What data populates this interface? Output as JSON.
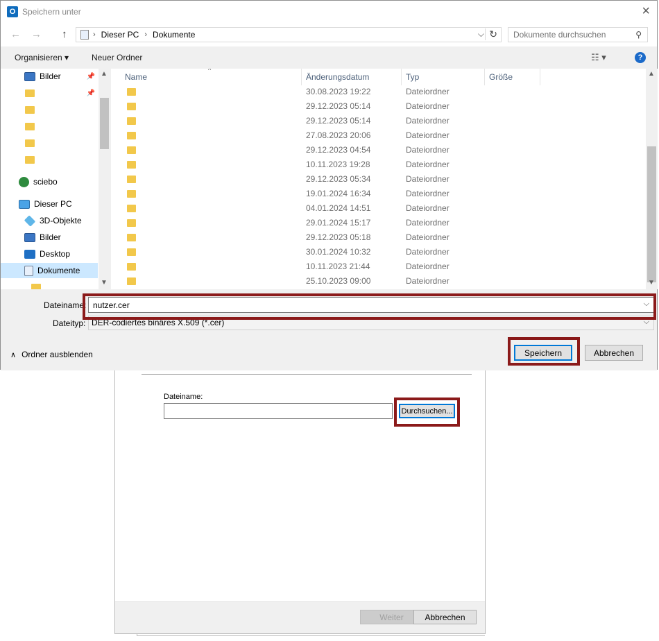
{
  "dialog": {
    "title": "Speichern unter",
    "app_icon": "O",
    "close_icon": "×"
  },
  "nav": {
    "back_icon": "←",
    "forward_icon": "→",
    "up_icon": "↑",
    "breadcrumb": [
      "Dieser PC",
      "Dokumente"
    ],
    "refresh_icon": "↻",
    "dropdown_icon": "⌵",
    "search_placeholder": "Dokumente durchsuchen",
    "search_icon": "⚲"
  },
  "toolbar": {
    "organize": "Organisieren ▾",
    "new_folder": "Neuer Ordner",
    "view_icon": "☷  ▾",
    "help_icon": "?"
  },
  "sidebar": {
    "items": [
      {
        "label": "Bilder",
        "icon": "pictures-icon"
      },
      {
        "label": "",
        "icon": "folder-icon"
      },
      {
        "label": "",
        "icon": "folder-icon"
      },
      {
        "label": "",
        "icon": "folder-icon"
      },
      {
        "label": "",
        "icon": "folder-icon"
      },
      {
        "label": "",
        "icon": "folder-icon"
      },
      {
        "label": "sciebo",
        "icon": "sciebo-icon"
      },
      {
        "label": "Dieser PC",
        "icon": "computer-icon"
      },
      {
        "label": "3D-Objekte",
        "icon": "3d-objects-icon"
      },
      {
        "label": "Bilder",
        "icon": "pictures-icon"
      },
      {
        "label": "Desktop",
        "icon": "desktop-icon"
      },
      {
        "label": "Dokumente",
        "icon": "documents-icon"
      }
    ]
  },
  "columns": [
    "Name",
    "Änderungsdatum",
    "Typ",
    "Größe"
  ],
  "files": [
    {
      "date": "30.08.2023 19:22",
      "type": "Dateiordner"
    },
    {
      "date": "29.12.2023 05:14",
      "type": "Dateiordner"
    },
    {
      "date": "29.12.2023 05:14",
      "type": "Dateiordner"
    },
    {
      "date": "27.08.2023 20:06",
      "type": "Dateiordner"
    },
    {
      "date": "29.12.2023 04:54",
      "type": "Dateiordner"
    },
    {
      "date": "10.11.2023 19:28",
      "type": "Dateiordner"
    },
    {
      "date": "29.12.2023 05:34",
      "type": "Dateiordner"
    },
    {
      "date": "19.01.2024 16:34",
      "type": "Dateiordner"
    },
    {
      "date": "04.01.2024 14:51",
      "type": "Dateiordner"
    },
    {
      "date": "29.01.2024 15:17",
      "type": "Dateiordner"
    },
    {
      "date": "29.12.2023 05:18",
      "type": "Dateiordner"
    },
    {
      "date": "30.01.2024 10:32",
      "type": "Dateiordner"
    },
    {
      "date": "10.11.2023 21:44",
      "type": "Dateiordner"
    },
    {
      "date": "25.10.2023 09:00",
      "type": "Dateiordner"
    }
  ],
  "form": {
    "filename_label": "Dateiname:",
    "filename_value": "nutzer.cer",
    "filetype_label": "Dateityp:",
    "filetype_value": "DER-codiertes binäres X.509 (*.cer)",
    "hide_folders": "Ordner ausblenden",
    "save": "Speichern",
    "cancel": "Abbrechen"
  },
  "wizard": {
    "filename_label": "Dateiname:",
    "browse": "Durchsuchen...",
    "next": "Weiter",
    "cancel": "Abbrechen"
  },
  "colors": {
    "highlight": "#8b1a1a",
    "accent": "#0078d7",
    "folder": "#f2c84b",
    "selection": "#cce8ff"
  }
}
